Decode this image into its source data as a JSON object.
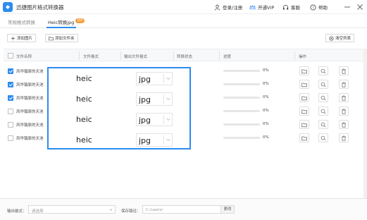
{
  "app": {
    "title": "迅捷图片格式转换器",
    "login": "登录/注册",
    "vip": "开通VIP",
    "service": "客服",
    "help": "帮助"
  },
  "tabs": [
    {
      "label": "常规格式转换",
      "active": false
    },
    {
      "label": "Heic转换jpg",
      "active": true
    }
  ],
  "vip_badge": "VIP",
  "toolbar": {
    "add_image": "添加图片",
    "add_folder": "添加文件夹",
    "clear_list": "清空列表"
  },
  "table": {
    "headers": {
      "filename": "文件名称",
      "format": "文件格式",
      "output_format": "输出文件格式",
      "status": "转换状态",
      "progress": "进度",
      "actions": "操作"
    },
    "rows": [
      {
        "filename": "风华镇原的天池",
        "checked": true,
        "progress": "0%",
        "progress_value": 0
      },
      {
        "filename": "风华镇原的天池",
        "checked": true,
        "progress": "0%",
        "progress_value": 0
      },
      {
        "filename": "风华镇原的天池",
        "checked": true,
        "progress": "0%",
        "progress_value": 0
      },
      {
        "filename": "风华镇原的天池",
        "checked": false,
        "progress": "0%",
        "progress_value": 0
      },
      {
        "filename": "风华镇原的天池",
        "checked": false,
        "progress": "0%",
        "progress_value": 0
      },
      {
        "filename": "风华镇原的天池",
        "checked": false,
        "progress": "0%",
        "progress_value": 0
      }
    ]
  },
  "overlay": {
    "rows": [
      {
        "format": "heic",
        "output": "jpg"
      },
      {
        "format": "heic",
        "output": "jpg"
      },
      {
        "format": "heic",
        "output": "jpg"
      },
      {
        "format": "heic",
        "output": "jpg"
      }
    ]
  },
  "footer": {
    "output_format_label": "输出格式：",
    "output_format_placeholder": "请选择",
    "save_path_label": "保存路径：",
    "save_path_value": "C:/users/",
    "change_button": "更改"
  },
  "colors": {
    "accent": "#2d8cf0",
    "vip": "#f7a240"
  }
}
